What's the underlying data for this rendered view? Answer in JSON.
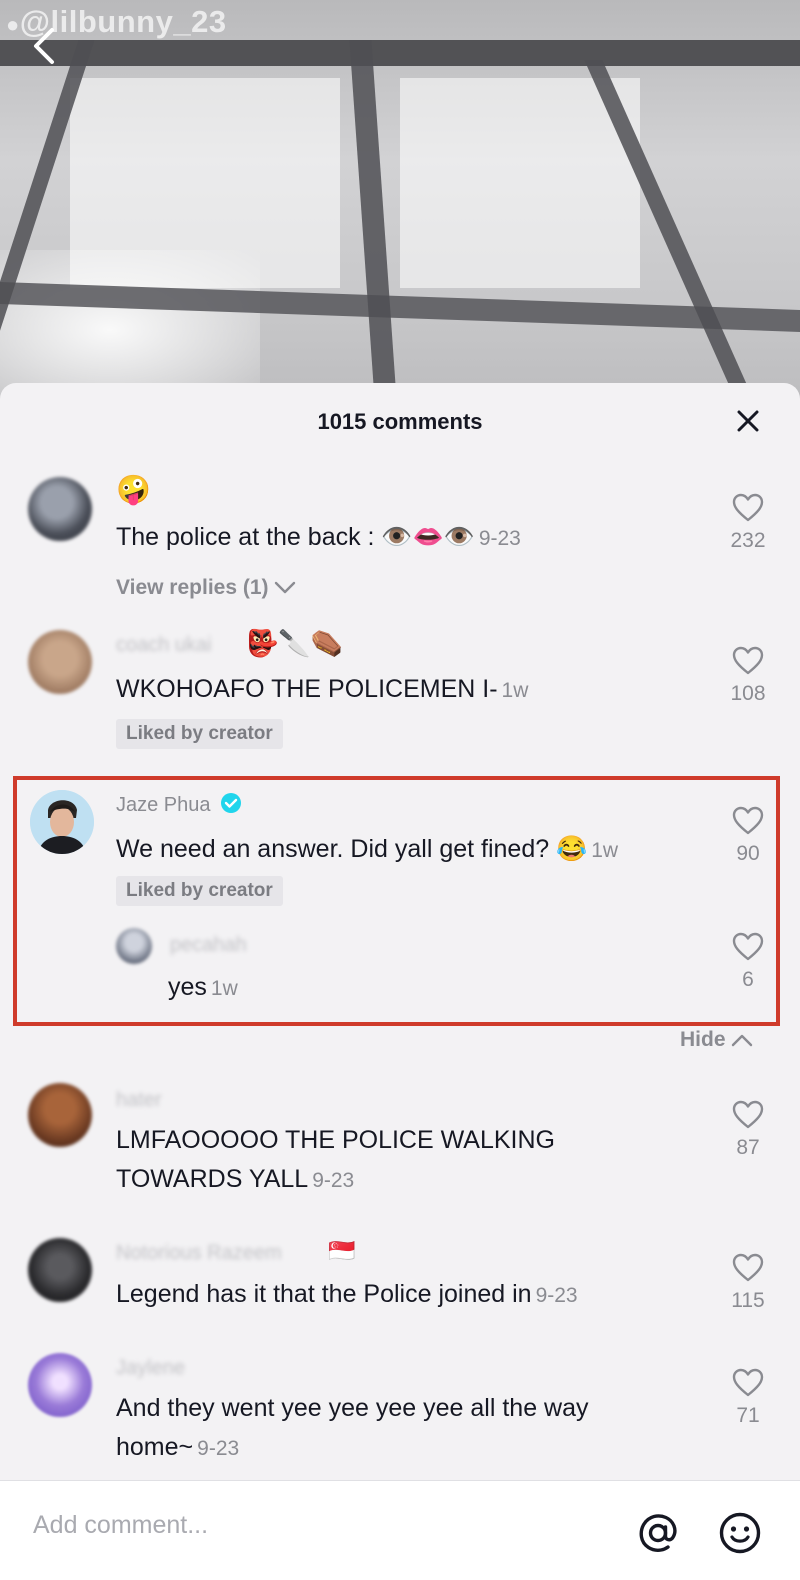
{
  "video": {
    "uploader_handle": "@lilbunny_23"
  },
  "sheet": {
    "title": "1015 comments"
  },
  "comments": [
    {
      "username": "",
      "username_emoji": "🤪",
      "text": "The police at the back : 👁️👄👁️",
      "timestamp": "9-23",
      "likes": "232",
      "view_replies": "View replies (1)"
    },
    {
      "username": "coach ukai",
      "username_emoji": "👺🔪⚰️",
      "text": "WKOHOAFO THE POLICEMEN I-",
      "timestamp": "1w",
      "likes": "108",
      "badge": "Liked by creator"
    },
    {
      "username": "Jaze Phua",
      "verified": true,
      "text": "We need an answer. Did yall get fined? 😂",
      "timestamp": "1w",
      "likes": "90",
      "badge": "Liked by creator",
      "reply": {
        "username": "pecahah",
        "text": "yes",
        "timestamp": "1w",
        "likes": "6"
      },
      "hide_label": "Hide"
    },
    {
      "username": "hater",
      "text_line1": "LMFAOOOOO THE POLICE WALKING",
      "text_line2": "TOWARDS YALL",
      "timestamp": "9-23",
      "likes": "87"
    },
    {
      "username": "Notorious Razeem",
      "username_emoji": "🇸🇬",
      "text": "Legend has it that the Police joined in",
      "timestamp": "9-23",
      "likes": "115"
    },
    {
      "username": "Jaylene",
      "text_line1": "And they went yee yee yee yee all the way",
      "text_line2": "home~",
      "timestamp": "9-23",
      "likes": "71"
    }
  ],
  "input": {
    "placeholder": "Add comment..."
  },
  "icons": {
    "back": "chevron-left-icon",
    "close": "close-icon",
    "like": "heart-outline-icon",
    "verified": "verified-badge-icon",
    "mention": "at-sign-icon",
    "emoji": "smiley-icon"
  },
  "colors": {
    "highlight_border": "#cf3b2b",
    "verified": "#20d5ec",
    "text_primary": "#161823",
    "text_secondary": "#8a8b91"
  }
}
